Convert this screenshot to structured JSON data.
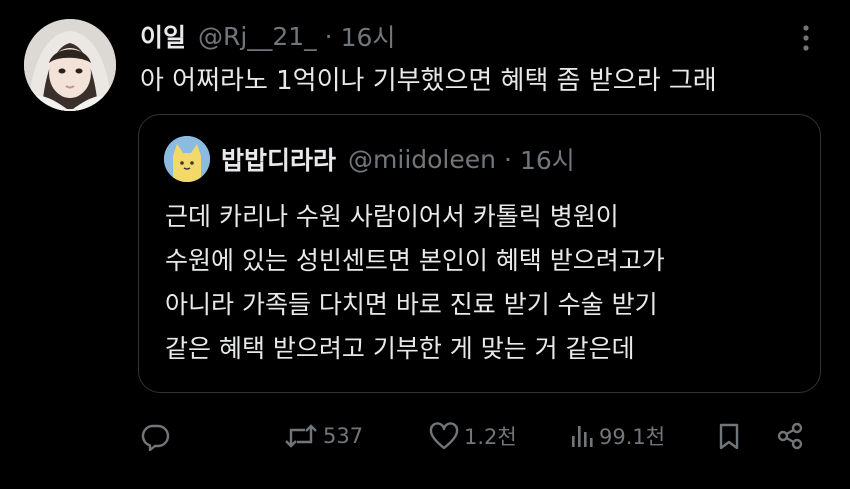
{
  "tweet": {
    "display_name": "이일",
    "handle": "@Rj__21_",
    "separator": "·",
    "time": "16시",
    "text": "아 어쩌라노 1억이나 기부했으면 혜택 좀 받으라 그래"
  },
  "quoted_tweet": {
    "display_name": "밥밥디라라",
    "handle": "@miidoleen",
    "separator": "·",
    "time": "16시",
    "lines": [
      "근데 카리나 수원 사람이어서 카톨릭 병원이",
      "수원에 있는 성빈센트면 본인이 혜택 받으려고가",
      "아니라 가족들 다치면 바로 진료 받기 수술 받기",
      "같은 혜택 받으려고 기부한 게 맞는 거 같은데"
    ]
  },
  "actions": {
    "reply_icon": "reply-icon",
    "retweet_icon": "retweet-icon",
    "retweet_count": "537",
    "like_icon": "heart-icon",
    "like_count": "1.2천",
    "views_icon": "analytics-icon",
    "views_count": "99.1천",
    "bookmark_icon": "bookmark-icon",
    "share_icon": "share-icon"
  },
  "colors": {
    "background": "#000000",
    "primary_text": "#e7e9ea",
    "secondary_text": "#71767b",
    "border": "#2f3336"
  }
}
